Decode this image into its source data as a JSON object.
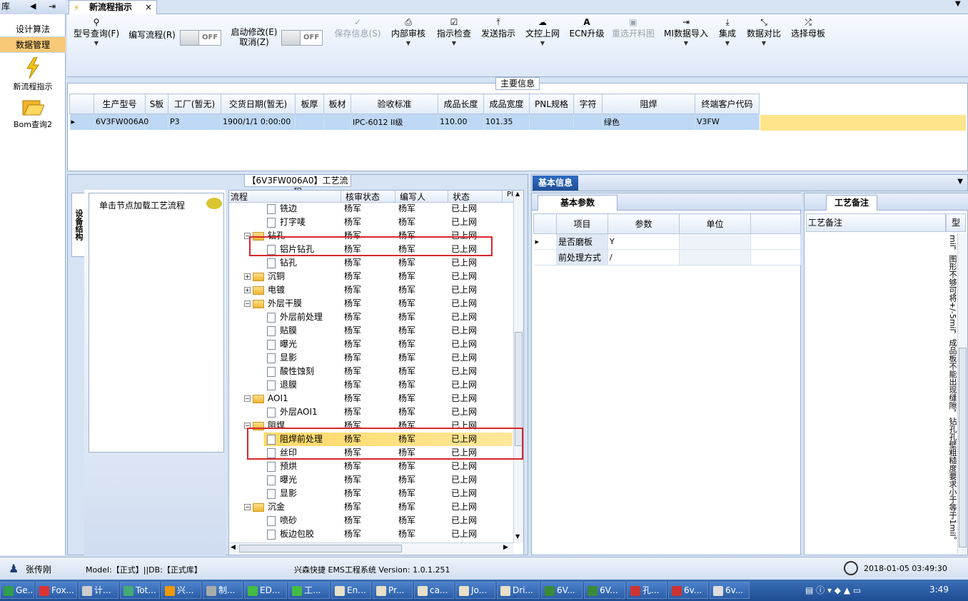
{
  "app": {
    "tab_title": "新流程指示",
    "tab_close": "×",
    "left_label": "库"
  },
  "nav": {
    "items": [
      "设计算法",
      "数据管理"
    ],
    "icons": [
      {
        "label": "新流程指示",
        "icon": "lightning-icon"
      },
      {
        "label": "Bom查询2",
        "icon": "folder-open-icon"
      }
    ]
  },
  "toolbar": {
    "buttons": [
      {
        "label": "型号查询(F)",
        "icon": "search-icon",
        "dropdown": true
      },
      {
        "label": "编写流程(R)",
        "icon": "",
        "dropdown": false
      },
      {
        "label": "启动修改(E)",
        "label2": "取消(Z)",
        "icon": "",
        "dropdown": false
      },
      {
        "label": "保存信息(S)",
        "icon": "check-icon",
        "disabled": true
      },
      {
        "label": "内部审核",
        "icon": "printer-icon",
        "dropdown": true
      },
      {
        "label": "指示检查",
        "icon": "checkbox-icon",
        "dropdown": true
      },
      {
        "label": "发送指示",
        "icon": "upload-icon"
      },
      {
        "label": "文控上网",
        "icon": "cloud-upload-icon",
        "dropdown": true
      },
      {
        "label": "ECN升级",
        "icon": "text-a-icon"
      },
      {
        "label": "重选开料图",
        "icon": "image-icon",
        "disabled": true
      },
      {
        "label": "MI数据导入",
        "icon": "import-icon",
        "dropdown": true
      },
      {
        "label": "集成",
        "icon": "download-icon",
        "dropdown": true
      },
      {
        "label": "数据对比",
        "icon": "compare-icon",
        "dropdown": true
      },
      {
        "label": "选择母板",
        "icon": "shuffle-icon"
      }
    ],
    "toggle1": "OFF",
    "toggle2": "OFF"
  },
  "main_info": {
    "title": "主要信息",
    "columns": [
      "生产型号",
      "S板",
      "工厂(暂无)",
      "交货日期(暂无)",
      "板厚",
      "板材",
      "验收标准",
      "成品长度",
      "成品宽度",
      "PNL规格",
      "字符",
      "阻焊",
      "终端客户代码"
    ],
    "row": [
      "6V3FW006A0",
      "",
      "P3",
      "1900/1/1 0:00:00",
      "",
      "",
      "IPC-6012 II级",
      "110.00",
      "101.35",
      "",
      "",
      "绿色",
      "V3FW"
    ]
  },
  "process": {
    "title": "【6V3FW006A0】工艺流程",
    "side_tab": "设备结构",
    "hint": "单击节点加载工艺流程",
    "columns": [
      "流程",
      "核审状态",
      "编写人",
      "状态",
      "PI"
    ],
    "rows": [
      {
        "name": "铣边",
        "level": 2,
        "type": "file",
        "reviewer": "杨军",
        "writer": "杨军",
        "status": "已上网"
      },
      {
        "name": "打字唛",
        "level": 2,
        "type": "file",
        "reviewer": "杨军",
        "writer": "杨军",
        "status": "已上网"
      },
      {
        "name": "钻孔",
        "level": 1,
        "type": "folder",
        "expand": "−",
        "reviewer": "杨军",
        "writer": "杨军",
        "status": "已上网"
      },
      {
        "name": "铝片钻孔",
        "level": 2,
        "type": "file",
        "reviewer": "杨军",
        "writer": "杨军",
        "status": "已上网"
      },
      {
        "name": "钻孔",
        "level": 2,
        "type": "file",
        "reviewer": "杨军",
        "writer": "杨军",
        "status": "已上网"
      },
      {
        "name": "沉铜",
        "level": 1,
        "type": "folder",
        "expand": "+",
        "reviewer": "杨军",
        "writer": "杨军",
        "status": "已上网"
      },
      {
        "name": "电镀",
        "level": 1,
        "type": "folder",
        "expand": "+",
        "reviewer": "杨军",
        "writer": "杨军",
        "status": "已上网"
      },
      {
        "name": "外层干膜",
        "level": 1,
        "type": "folder",
        "expand": "−",
        "reviewer": "杨军",
        "writer": "杨军",
        "status": "已上网"
      },
      {
        "name": "外层前处理",
        "level": 2,
        "type": "file",
        "reviewer": "杨军",
        "writer": "杨军",
        "status": "已上网"
      },
      {
        "name": "贴膜",
        "level": 2,
        "type": "file",
        "reviewer": "杨军",
        "writer": "杨军",
        "status": "已上网"
      },
      {
        "name": "曝光",
        "level": 2,
        "type": "file",
        "reviewer": "杨军",
        "writer": "杨军",
        "status": "已上网"
      },
      {
        "name": "显影",
        "level": 2,
        "type": "file",
        "reviewer": "杨军",
        "writer": "杨军",
        "status": "已上网"
      },
      {
        "name": "酸性蚀刻",
        "level": 2,
        "type": "file",
        "reviewer": "杨军",
        "writer": "杨军",
        "status": "已上网"
      },
      {
        "name": "退膜",
        "level": 2,
        "type": "file",
        "reviewer": "杨军",
        "writer": "杨军",
        "status": "已上网"
      },
      {
        "name": "AOI1",
        "level": 1,
        "type": "folder",
        "expand": "−",
        "reviewer": "杨军",
        "writer": "杨军",
        "status": "已上网"
      },
      {
        "name": "外层AOI1",
        "level": 2,
        "type": "file",
        "reviewer": "杨军",
        "writer": "杨军",
        "status": "已上网"
      },
      {
        "name": "阻焊",
        "level": 1,
        "type": "folder",
        "expand": "−",
        "reviewer": "杨军",
        "writer": "杨军",
        "status": "已上网"
      },
      {
        "name": "阻焊前处理",
        "level": 2,
        "type": "file",
        "reviewer": "杨军",
        "writer": "杨军",
        "status": "已上网",
        "selected": true
      },
      {
        "name": "丝印",
        "level": 2,
        "type": "file",
        "reviewer": "杨军",
        "writer": "杨军",
        "status": "已上网"
      },
      {
        "name": "预烘",
        "level": 2,
        "type": "file",
        "reviewer": "杨军",
        "writer": "杨军",
        "status": "已上网"
      },
      {
        "name": "曝光",
        "level": 2,
        "type": "file",
        "reviewer": "杨军",
        "writer": "杨军",
        "status": "已上网"
      },
      {
        "name": "显影",
        "level": 2,
        "type": "file",
        "reviewer": "杨军",
        "writer": "杨军",
        "status": "已上网"
      },
      {
        "name": "沉金",
        "level": 1,
        "type": "folder",
        "expand": "−",
        "reviewer": "杨军",
        "writer": "杨军",
        "status": "已上网"
      },
      {
        "name": "喷砂",
        "level": 2,
        "type": "file",
        "reviewer": "杨军",
        "writer": "杨军",
        "status": "已上网"
      },
      {
        "name": "板边包胶",
        "level": 2,
        "type": "file",
        "reviewer": "杨军",
        "writer": "杨军",
        "status": "已上网"
      }
    ]
  },
  "basic_info": {
    "header": "基本信息",
    "tab": "基本参数",
    "columns": [
      "项目",
      "参数",
      "单位"
    ],
    "rows": [
      {
        "item": "是否磨板",
        "param": "Y",
        "unit": ""
      },
      {
        "item": "前处理方式",
        "param": "/",
        "unit": ""
      }
    ]
  },
  "remark": {
    "tab": "工艺备注",
    "col1": "工艺备注",
    "col2": "型",
    "vertical_text": "mil，图形不够可将+/-5mil，成品板不能出现缝隙，钻孔孔壁粗糙度要求小于等于1mil。"
  },
  "status": {
    "user": "张传刚",
    "model": "Model:【正式】||DB:【正式库】",
    "system": "兴森快捷 EMS工程系统 Version: 1.0.1.251",
    "datetime": "2018-01-05 03:49:30"
  },
  "taskbar": {
    "items": [
      {
        "label": "Ge...",
        "color": "#2f9e4f"
      },
      {
        "label": "Fox...",
        "color": "#d33"
      },
      {
        "label": "计...",
        "color": "#ccc"
      },
      {
        "label": "Tot...",
        "color": "#4a7"
      },
      {
        "label": "兴...",
        "color": "#e90"
      },
      {
        "label": "制...",
        "color": "#aaa"
      },
      {
        "label": "ED...",
        "color": "#4b4"
      },
      {
        "label": "工...",
        "color": "#4b4"
      },
      {
        "label": "En...",
        "color": "#e8e0c8"
      },
      {
        "label": "Pr...",
        "color": "#e8e0c8"
      },
      {
        "label": "ca...",
        "color": "#e8e0c8"
      },
      {
        "label": "Jo...",
        "color": "#e8e0c8"
      },
      {
        "label": "Dri...",
        "color": "#e8e0c8"
      },
      {
        "label": "6V...",
        "color": "#3a8a3a"
      },
      {
        "label": "6V...",
        "color": "#3a8a3a"
      },
      {
        "label": "孔...",
        "color": "#c33"
      },
      {
        "label": "6v...",
        "color": "#c33"
      },
      {
        "label": "6v...",
        "color": "#ddd"
      }
    ],
    "clock": "3:49"
  }
}
